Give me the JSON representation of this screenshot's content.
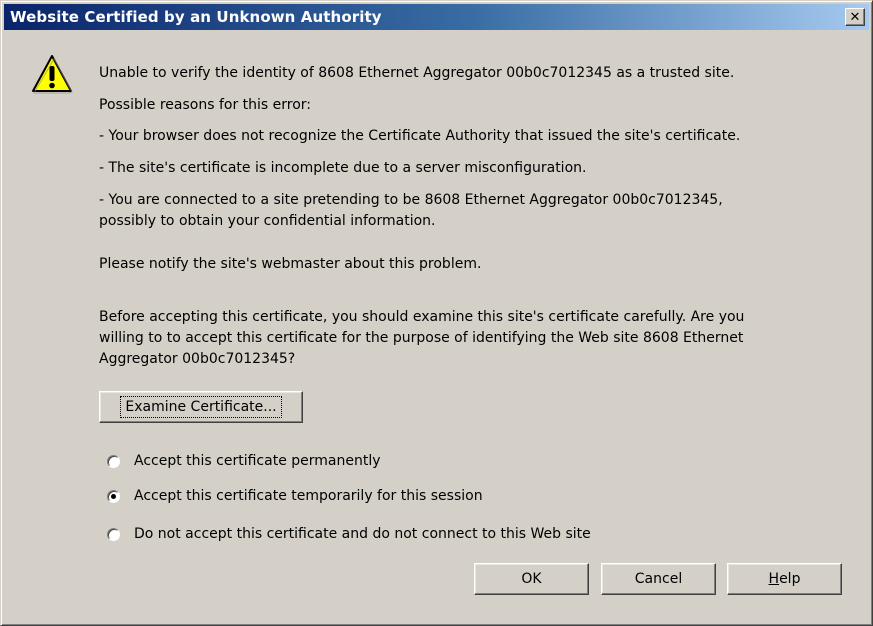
{
  "window": {
    "title": "Website Certified by an Unknown Authority",
    "close_label": "✕"
  },
  "icon": "warning-icon",
  "message": {
    "line1": "Unable to verify the identity of 8608 Ethernet Aggregator 00b0c7012345 as a trusted site.",
    "reasons_header": "Possible reasons for this error:",
    "reason1": "- Your browser does not recognize the Certificate Authority that issued the site's certificate.",
    "reason2": "- The site's certificate is incomplete due to a server misconfiguration.",
    "reason3_line1": "- You are connected to a site pretending to be 8608 Ethernet Aggregator 00b0c7012345,",
    "reason3_line2": "possibly to obtain your confidential information.",
    "notify": "Please notify the site's webmaster about this problem.",
    "before1": "Before accepting this certificate, you should examine this site's certificate carefully. Are you",
    "before2": "willing to to accept this certificate for the purpose of identifying the Web site 8608 Ethernet",
    "before3": "Aggregator 00b0c7012345?"
  },
  "examine_button": "Examine Certificate...",
  "options": [
    {
      "label": "Accept this certificate permanently",
      "selected": false
    },
    {
      "label": "Accept this certificate temporarily for this session",
      "selected": true
    },
    {
      "label": "Do not accept this certificate and do not connect to this Web site",
      "selected": false
    }
  ],
  "buttons": {
    "ok": "OK",
    "cancel": "Cancel",
    "help_prefix": "",
    "help_underlined": "H",
    "help_rest": "elp"
  },
  "colors": {
    "dialog_bg": "#d4d0c8",
    "title_gradient_start": "#0a246a",
    "title_gradient_end": "#a6caf0",
    "warning_yellow": "#ffff00"
  }
}
